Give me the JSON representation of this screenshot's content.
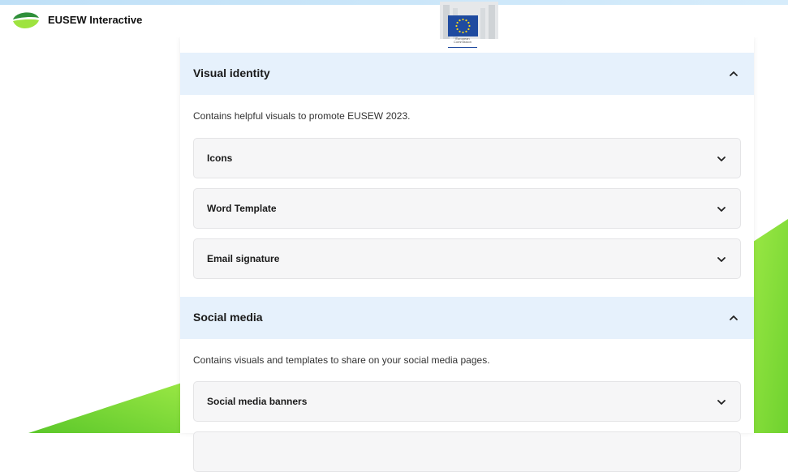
{
  "header": {
    "brand": "EUSEW Interactive",
    "ec_logo_text": "European Commission"
  },
  "sections": [
    {
      "title": "Visual identity",
      "description": "Contains helpful visuals to promote EUSEW 2023.",
      "items": [
        "Icons",
        "Word Template",
        "Email signature"
      ]
    },
    {
      "title": "Social media",
      "description": "Contains visuals and templates to share on your social media pages.",
      "items": [
        "Social media banners"
      ]
    }
  ],
  "colors": {
    "accent_green": "#8be03a",
    "section_header_bg": "#e6f1fc",
    "ec_blue": "#1f4ba0",
    "ec_stars": "#ffd617"
  },
  "icons": {
    "expanded": "chevron-up-icon",
    "collapsed": "chevron-down-icon"
  }
}
